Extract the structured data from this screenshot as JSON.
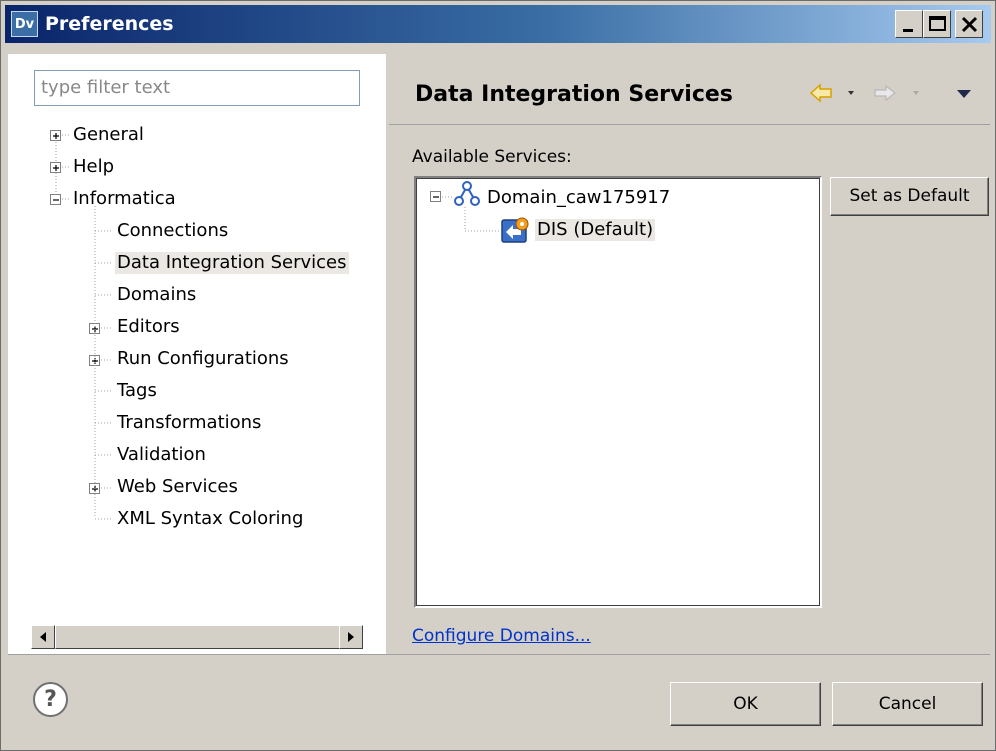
{
  "window": {
    "app_icon": "Dv",
    "title": "Preferences",
    "controls": [
      "minimize-icon",
      "maximize-icon",
      "close-icon"
    ]
  },
  "filter": {
    "placeholder": "type filter text"
  },
  "tree": {
    "general": "General",
    "help": "Help",
    "informatica": "Informatica",
    "connections": "Connections",
    "data_integration_services": "Data Integration Services",
    "domains": "Domains",
    "editors": "Editors",
    "run_configurations": "Run Configurations",
    "tags": "Tags",
    "transformations": "Transformations",
    "validation": "Validation",
    "web_services": "Web Services",
    "xml_syntax_coloring": "XML Syntax Coloring"
  },
  "page": {
    "title": "Data Integration Services",
    "available_label": "Available Services:",
    "domain_node": "Domain_caw175917",
    "service_node": "DIS (Default)",
    "set_default_button": "Set as Default",
    "configure_link": "Configure Domains..."
  },
  "footer": {
    "help_icon": "?",
    "ok": "OK",
    "cancel": "Cancel"
  },
  "colors": {
    "title_start": "#0a246a",
    "title_end": "#a6caf0",
    "link": "#0033cc",
    "nav_arrow": "#f0c020"
  }
}
